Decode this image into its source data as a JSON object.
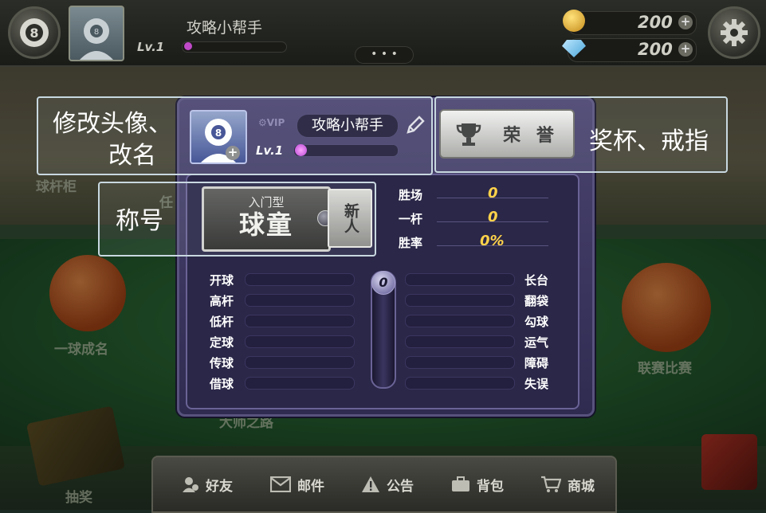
{
  "topbar": {
    "player_name": "攻略小帮手",
    "level_small": "Lv.1",
    "coins": "200",
    "gems": "200",
    "dots": "• • •"
  },
  "background_labels": {
    "left_top": "球杆柜",
    "left_mid": "一球成名",
    "left_bottom": "抽奖",
    "right_mid": "联赛比赛",
    "center_bottom": "大师之路",
    "mid_partial": "任"
  },
  "profile": {
    "vip_label": "VIP",
    "name": "攻略小帮手",
    "level": "Lv.1",
    "honor_button": "荣 誉"
  },
  "title_badge": {
    "small": "入门型",
    "big": "球童",
    "tag": "新人"
  },
  "summary_stats": [
    {
      "label": "胜场",
      "value": "0"
    },
    {
      "label": "一杆",
      "value": "0"
    },
    {
      "label": "胜率",
      "value": "0%"
    }
  ],
  "skills_left": [
    "开球",
    "高杆",
    "低杆",
    "定球",
    "传球",
    "借球"
  ],
  "skills_right": [
    "长台",
    "翻袋",
    "勾球",
    "运气",
    "障碍",
    "失误"
  ],
  "center_gauge_value": "0",
  "annotations": {
    "avatar_rename": [
      "修改头像、",
      "改名"
    ],
    "trophy_ring": "奖杯、戒指",
    "title": "称号"
  },
  "bottom_nav": [
    {
      "label": "好友",
      "icon": "friends-icon"
    },
    {
      "label": "邮件",
      "icon": "mail-icon"
    },
    {
      "label": "公告",
      "icon": "warning-icon"
    },
    {
      "label": "背包",
      "icon": "bag-icon"
    },
    {
      "label": "商城",
      "icon": "cart-icon"
    }
  ],
  "colors": {
    "panel": "#3b3660",
    "stat_value": "#ffd24a",
    "annotation_border": "#c8d8e0"
  }
}
